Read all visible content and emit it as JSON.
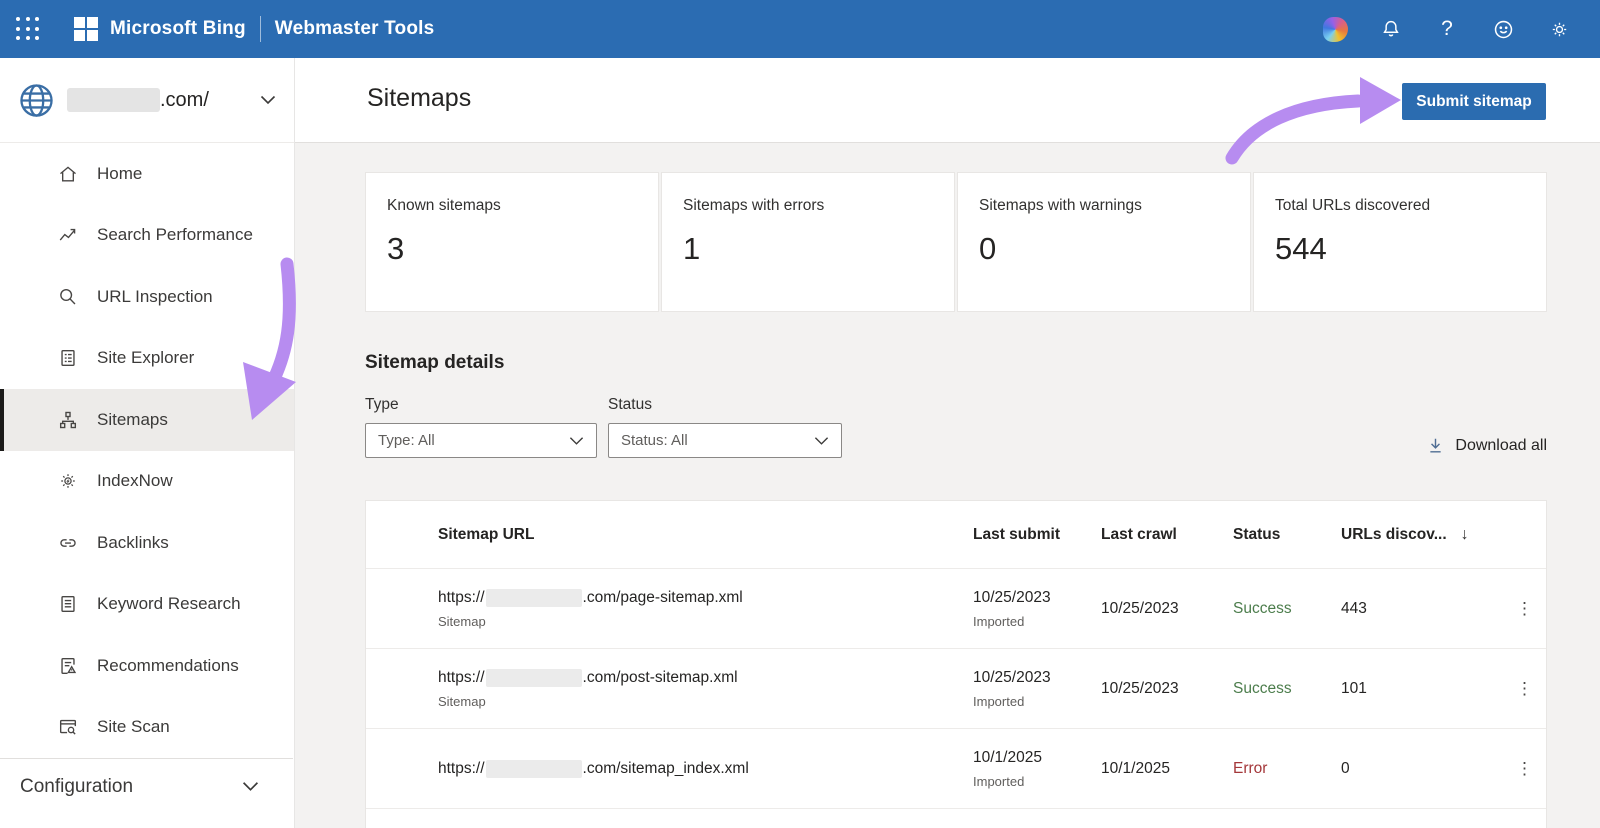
{
  "topbar": {
    "brand": "Microsoft Bing",
    "product": "Webmaster Tools",
    "icons": [
      "waffle-icon",
      "copilot-icon",
      "bell-icon",
      "help-icon",
      "feedback-icon",
      "settings-icon"
    ],
    "bar_color": "#2b6cb2"
  },
  "sidebar": {
    "site": {
      "domain_suffix": ".com/"
    },
    "items": [
      {
        "label": "Home",
        "icon": "home-icon"
      },
      {
        "label": "Search Performance",
        "icon": "trend-icon"
      },
      {
        "label": "URL Inspection",
        "icon": "magnifier-icon"
      },
      {
        "label": "Site Explorer",
        "icon": "document-list-icon"
      },
      {
        "label": "Sitemaps",
        "icon": "hierarchy-icon",
        "selected": true
      },
      {
        "label": "IndexNow",
        "icon": "gear-bolt-icon"
      },
      {
        "label": "Backlinks",
        "icon": "link-icon"
      },
      {
        "label": "Keyword Research",
        "icon": "document-icon"
      },
      {
        "label": "Recommendations",
        "icon": "document-warning-icon"
      },
      {
        "label": "Site Scan",
        "icon": "browser-scan-icon"
      }
    ],
    "configuration": {
      "label": "Configuration"
    }
  },
  "header": {
    "title": "Sitemaps",
    "submit_button": "Submit sitemap",
    "button_color": "#2b6cb0"
  },
  "stats": [
    {
      "label": "Known sitemaps",
      "value": "3"
    },
    {
      "label": "Sitemaps with errors",
      "value": "1"
    },
    {
      "label": "Sitemaps with warnings",
      "value": "0"
    },
    {
      "label": "Total URLs discovered",
      "value": "544"
    }
  ],
  "details": {
    "heading": "Sitemap details",
    "filters": [
      {
        "label": "Type",
        "value": "Type: All"
      },
      {
        "label": "Status",
        "value": "Status: All"
      }
    ],
    "download_all": "Download all"
  },
  "table": {
    "columns": [
      "Sitemap URL",
      "Last submit",
      "Last crawl",
      "Status",
      "URLs discov..."
    ],
    "sort_icon": "↓",
    "rows": [
      {
        "url_prefix": "https://",
        "url_suffix": ".com/page-sitemap.xml",
        "type_label": "Sitemap",
        "last_submit": "10/25/2023",
        "submit_note": "Imported",
        "last_crawl": "10/25/2023",
        "status": "Success",
        "urls": "443"
      },
      {
        "url_prefix": "https://",
        "url_suffix": ".com/post-sitemap.xml",
        "type_label": "Sitemap",
        "last_submit": "10/25/2023",
        "submit_note": "Imported",
        "last_crawl": "10/25/2023",
        "status": "Success",
        "urls": "101"
      },
      {
        "url_prefix": "https://",
        "url_suffix": ".com/sitemap_index.xml",
        "type_label": "",
        "last_submit": "10/1/2025",
        "submit_note": "Imported",
        "last_crawl": "10/1/2025",
        "status": "Error",
        "urls": "0"
      }
    ],
    "kebab": "⋮"
  },
  "colors": {
    "success": "#4c7d4c",
    "error": "#a4373a",
    "annotation_purple": "#b78cf0",
    "background_gray": "#f3f2f1"
  }
}
